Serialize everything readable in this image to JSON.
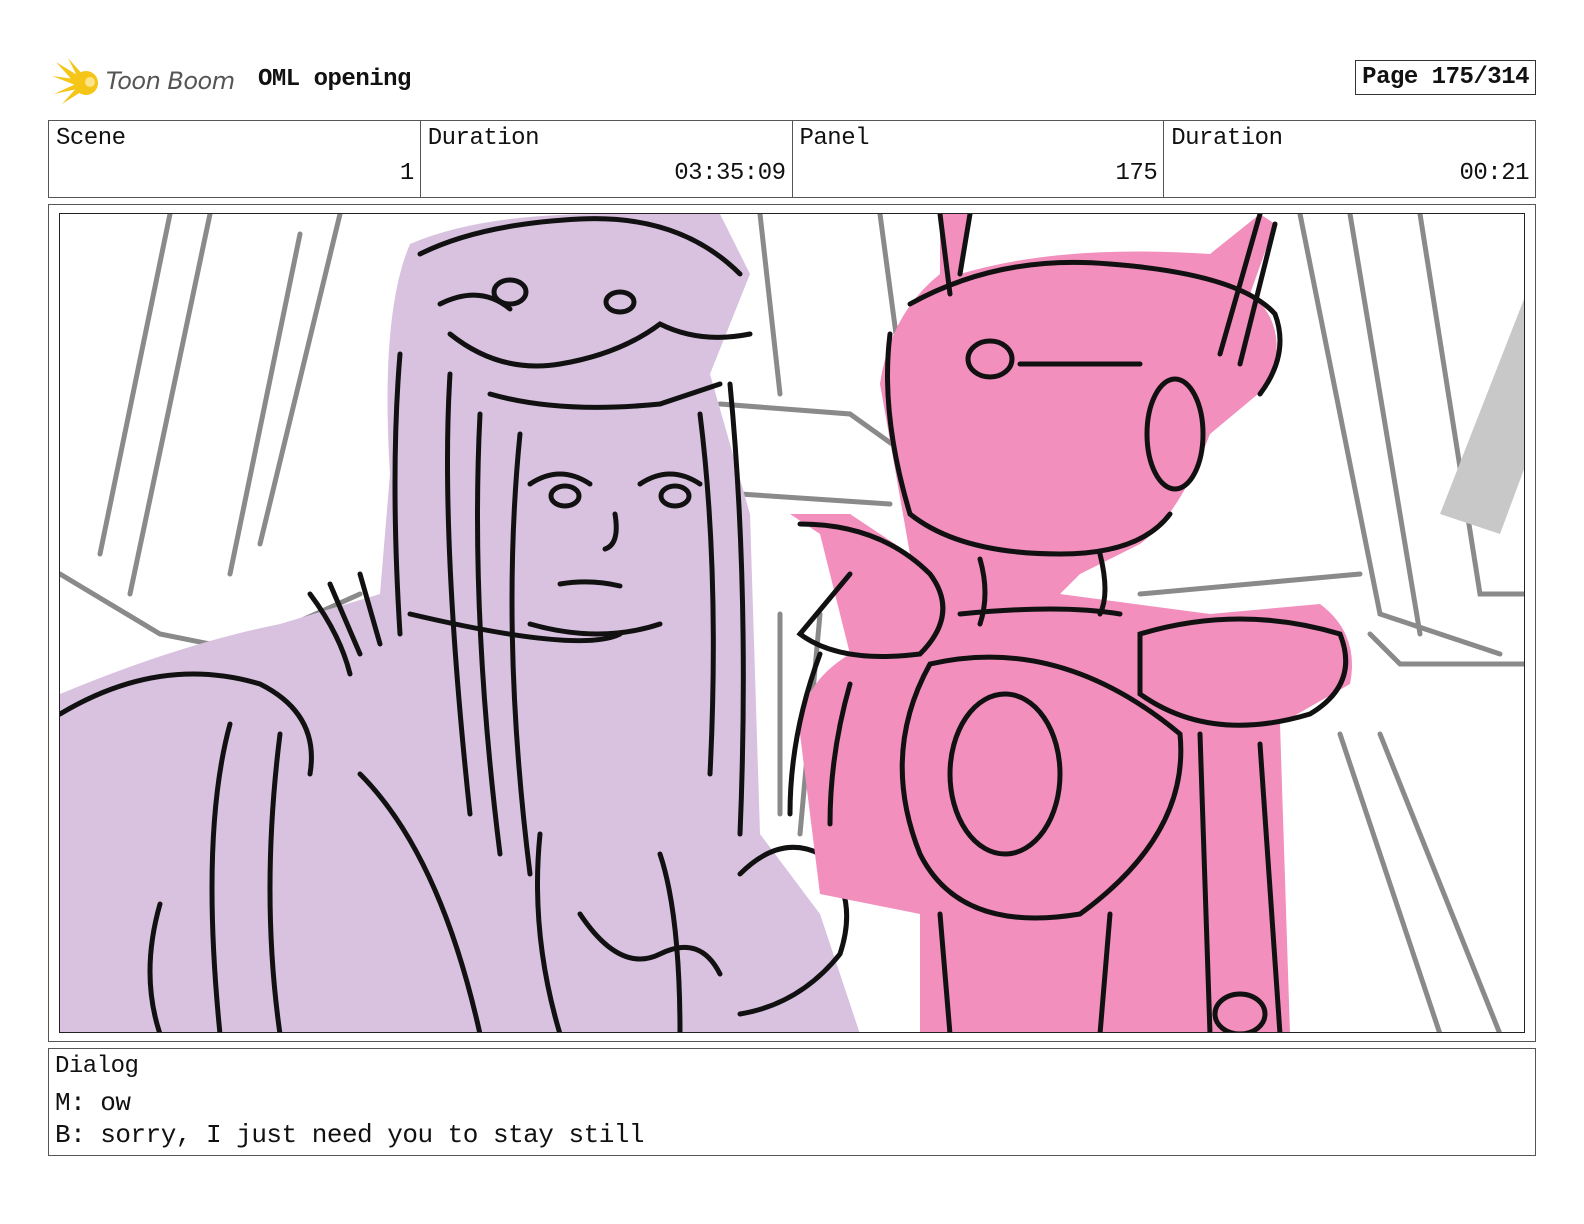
{
  "header": {
    "logo_text": "Toon Boom",
    "project_title": "OML opening",
    "page_label": "Page 175/314"
  },
  "info": {
    "scene_label": "Scene",
    "scene_value": "1",
    "scene_duration_label": "Duration",
    "scene_duration_value": "03:35:09",
    "panel_label": "Panel",
    "panel_value": "175",
    "panel_duration_label": "Duration",
    "panel_duration_value": "00:21"
  },
  "dialog": {
    "label": "Dialog",
    "lines": [
      "M: ow",
      "B: sorry, I just need you to stay still"
    ]
  },
  "colors": {
    "girl_fill": "#d9c2e0",
    "robot_fill": "#f28fbd",
    "sketch_gray": "#8a8a8a",
    "logo_yellow": "#f5c518"
  }
}
